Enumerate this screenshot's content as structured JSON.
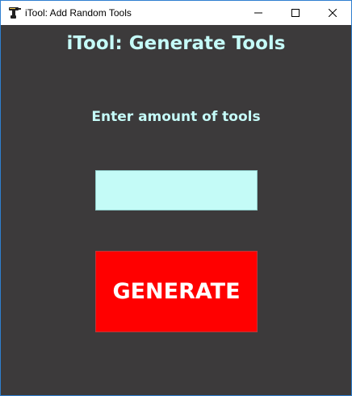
{
  "window": {
    "title": "iTool: Add Random Tools",
    "icon": "drill-icon",
    "controls": {
      "minimize_icon": "minimize-icon",
      "maximize_icon": "maximize-icon",
      "close_icon": "close-icon"
    }
  },
  "main": {
    "heading": "iTool: Generate Tools",
    "prompt": "Enter amount of tools",
    "amount_input": {
      "value": "",
      "placeholder": ""
    },
    "generate_button_label": "GENERATE"
  },
  "colors": {
    "background": "#3c3a3b",
    "text_accent": "#c5fbf8",
    "input_background": "#c4fbf7",
    "button_background": "#ff0000",
    "button_text": "#ffffff",
    "window_border": "#2f7fd0"
  }
}
